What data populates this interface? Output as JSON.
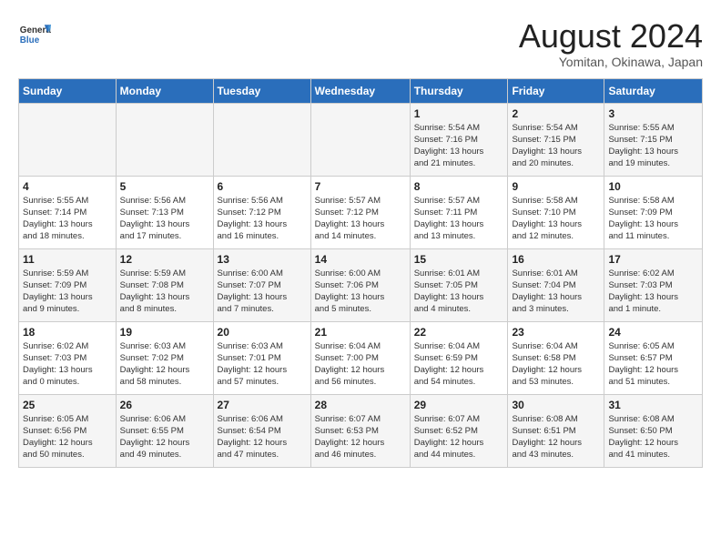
{
  "header": {
    "logo_general": "General",
    "logo_blue": "Blue",
    "title": "August 2024",
    "subtitle": "Yomitan, Okinawa, Japan"
  },
  "days_of_week": [
    "Sunday",
    "Monday",
    "Tuesday",
    "Wednesday",
    "Thursday",
    "Friday",
    "Saturday"
  ],
  "weeks": [
    [
      {
        "day": "",
        "info": ""
      },
      {
        "day": "",
        "info": ""
      },
      {
        "day": "",
        "info": ""
      },
      {
        "day": "",
        "info": ""
      },
      {
        "day": "1",
        "info": "Sunrise: 5:54 AM\nSunset: 7:16 PM\nDaylight: 13 hours\nand 21 minutes."
      },
      {
        "day": "2",
        "info": "Sunrise: 5:54 AM\nSunset: 7:15 PM\nDaylight: 13 hours\nand 20 minutes."
      },
      {
        "day": "3",
        "info": "Sunrise: 5:55 AM\nSunset: 7:15 PM\nDaylight: 13 hours\nand 19 minutes."
      }
    ],
    [
      {
        "day": "4",
        "info": "Sunrise: 5:55 AM\nSunset: 7:14 PM\nDaylight: 13 hours\nand 18 minutes."
      },
      {
        "day": "5",
        "info": "Sunrise: 5:56 AM\nSunset: 7:13 PM\nDaylight: 13 hours\nand 17 minutes."
      },
      {
        "day": "6",
        "info": "Sunrise: 5:56 AM\nSunset: 7:12 PM\nDaylight: 13 hours\nand 16 minutes."
      },
      {
        "day": "7",
        "info": "Sunrise: 5:57 AM\nSunset: 7:12 PM\nDaylight: 13 hours\nand 14 minutes."
      },
      {
        "day": "8",
        "info": "Sunrise: 5:57 AM\nSunset: 7:11 PM\nDaylight: 13 hours\nand 13 minutes."
      },
      {
        "day": "9",
        "info": "Sunrise: 5:58 AM\nSunset: 7:10 PM\nDaylight: 13 hours\nand 12 minutes."
      },
      {
        "day": "10",
        "info": "Sunrise: 5:58 AM\nSunset: 7:09 PM\nDaylight: 13 hours\nand 11 minutes."
      }
    ],
    [
      {
        "day": "11",
        "info": "Sunrise: 5:59 AM\nSunset: 7:09 PM\nDaylight: 13 hours\nand 9 minutes."
      },
      {
        "day": "12",
        "info": "Sunrise: 5:59 AM\nSunset: 7:08 PM\nDaylight: 13 hours\nand 8 minutes."
      },
      {
        "day": "13",
        "info": "Sunrise: 6:00 AM\nSunset: 7:07 PM\nDaylight: 13 hours\nand 7 minutes."
      },
      {
        "day": "14",
        "info": "Sunrise: 6:00 AM\nSunset: 7:06 PM\nDaylight: 13 hours\nand 5 minutes."
      },
      {
        "day": "15",
        "info": "Sunrise: 6:01 AM\nSunset: 7:05 PM\nDaylight: 13 hours\nand 4 minutes."
      },
      {
        "day": "16",
        "info": "Sunrise: 6:01 AM\nSunset: 7:04 PM\nDaylight: 13 hours\nand 3 minutes."
      },
      {
        "day": "17",
        "info": "Sunrise: 6:02 AM\nSunset: 7:03 PM\nDaylight: 13 hours\nand 1 minute."
      }
    ],
    [
      {
        "day": "18",
        "info": "Sunrise: 6:02 AM\nSunset: 7:03 PM\nDaylight: 13 hours\nand 0 minutes."
      },
      {
        "day": "19",
        "info": "Sunrise: 6:03 AM\nSunset: 7:02 PM\nDaylight: 12 hours\nand 58 minutes."
      },
      {
        "day": "20",
        "info": "Sunrise: 6:03 AM\nSunset: 7:01 PM\nDaylight: 12 hours\nand 57 minutes."
      },
      {
        "day": "21",
        "info": "Sunrise: 6:04 AM\nSunset: 7:00 PM\nDaylight: 12 hours\nand 56 minutes."
      },
      {
        "day": "22",
        "info": "Sunrise: 6:04 AM\nSunset: 6:59 PM\nDaylight: 12 hours\nand 54 minutes."
      },
      {
        "day": "23",
        "info": "Sunrise: 6:04 AM\nSunset: 6:58 PM\nDaylight: 12 hours\nand 53 minutes."
      },
      {
        "day": "24",
        "info": "Sunrise: 6:05 AM\nSunset: 6:57 PM\nDaylight: 12 hours\nand 51 minutes."
      }
    ],
    [
      {
        "day": "25",
        "info": "Sunrise: 6:05 AM\nSunset: 6:56 PM\nDaylight: 12 hours\nand 50 minutes."
      },
      {
        "day": "26",
        "info": "Sunrise: 6:06 AM\nSunset: 6:55 PM\nDaylight: 12 hours\nand 49 minutes."
      },
      {
        "day": "27",
        "info": "Sunrise: 6:06 AM\nSunset: 6:54 PM\nDaylight: 12 hours\nand 47 minutes."
      },
      {
        "day": "28",
        "info": "Sunrise: 6:07 AM\nSunset: 6:53 PM\nDaylight: 12 hours\nand 46 minutes."
      },
      {
        "day": "29",
        "info": "Sunrise: 6:07 AM\nSunset: 6:52 PM\nDaylight: 12 hours\nand 44 minutes."
      },
      {
        "day": "30",
        "info": "Sunrise: 6:08 AM\nSunset: 6:51 PM\nDaylight: 12 hours\nand 43 minutes."
      },
      {
        "day": "31",
        "info": "Sunrise: 6:08 AM\nSunset: 6:50 PM\nDaylight: 12 hours\nand 41 minutes."
      }
    ]
  ]
}
